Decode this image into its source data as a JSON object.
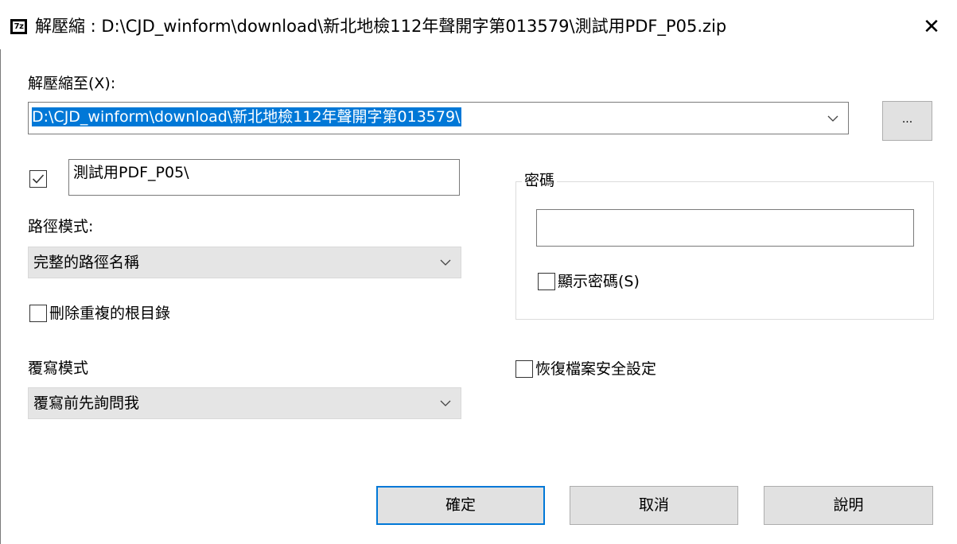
{
  "window": {
    "app_icon_text": "7z",
    "title": "解壓縮 : D:\\CJD_winform\\download\\新北地檢112年聲開字第013579\\測試用PDF_P05.zip",
    "close_glyph": "✕"
  },
  "extract_to": {
    "label": "解壓縮至(X):",
    "path": "D:\\CJD_winform\\download\\新北地檢112年聲開字第013579\\",
    "browse_label": "..."
  },
  "subfolder": {
    "checked": true,
    "value": "測試用PDF_P05\\"
  },
  "path_mode": {
    "label": "路徑模式:",
    "selected": "完整的路徑名稱"
  },
  "remove_duplicate_root": {
    "checked": false,
    "label": "刪除重複的根目錄"
  },
  "overwrite_mode": {
    "label": "覆寫模式",
    "selected": "覆寫前先詢問我"
  },
  "password": {
    "group_label": "密碼",
    "value": "",
    "show_password_checked": false,
    "show_password_label": "顯示密碼(S)"
  },
  "restore_security": {
    "checked": false,
    "label": "恢復檔案安全設定"
  },
  "buttons": {
    "ok": "確定",
    "cancel": "取消",
    "help": "說明"
  },
  "colors": {
    "accent": "#0078d7",
    "button_face": "#e1e1e1",
    "combo_gray": "#e5e5e5"
  }
}
